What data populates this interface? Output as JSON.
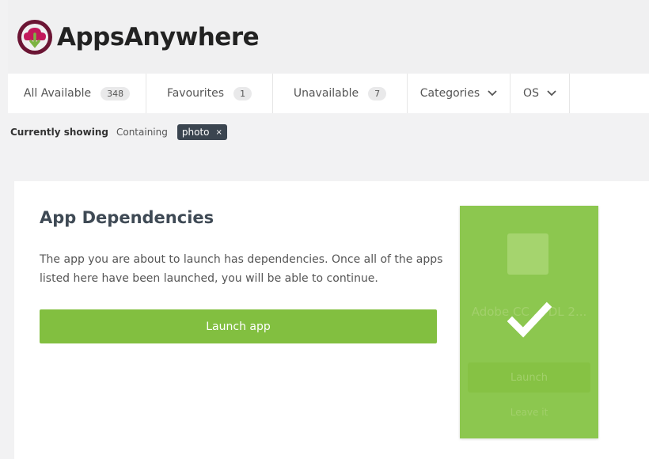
{
  "brand": {
    "name": "AppsAnywhere",
    "icon": "cloud-download-icon"
  },
  "nav": {
    "all_available": {
      "label": "All Available",
      "count": "348"
    },
    "favourites": {
      "label": "Favourites",
      "count": "1"
    },
    "unavailable": {
      "label": "Unavailable",
      "count": "7"
    },
    "categories": {
      "label": "Categories",
      "icon": "chevron-down-icon"
    },
    "os": {
      "label": "OS",
      "icon": "chevron-down-icon"
    }
  },
  "filter": {
    "label": "Currently showing",
    "mode": "Containing",
    "chip": "photo",
    "chip_close": "×"
  },
  "dialog": {
    "title": "App Dependencies",
    "description": "The app you are about to launch has dependencies. Once all of the apps listed here have been launched, you will be able to continue.",
    "launch_button": "Launch app"
  },
  "tile": {
    "name": "Adobe CC ... DL 2...",
    "subtitle": "",
    "button": "Launch",
    "link": "Leave it",
    "status_icon": "checkmark-icon",
    "background": "#8cc74f"
  },
  "colors": {
    "accent": "#82bf40",
    "chip": "#3b4550",
    "title": "#3f4a55"
  }
}
